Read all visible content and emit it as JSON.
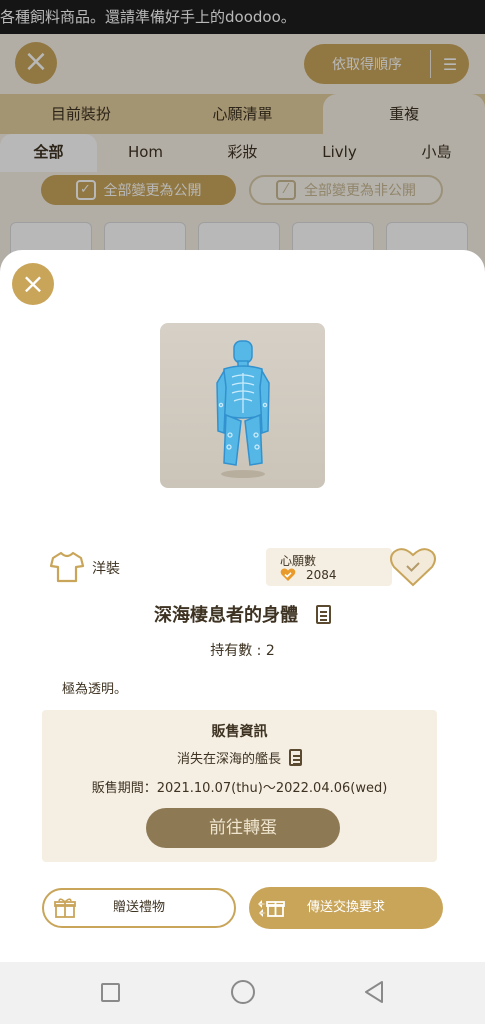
{
  "ticker": {
    "text": "各種飼料商品。還請準備好手上的doodoo。"
  },
  "background": {
    "close_icon": "close-icon",
    "sort_label": "依取得順序",
    "main_tabs": [
      {
        "label": "目前裝扮"
      },
      {
        "label": "心願清單"
      },
      {
        "label": "重複"
      }
    ],
    "sub_tabs": [
      {
        "label": "全部"
      },
      {
        "label": "Hom"
      },
      {
        "label": "彩妝"
      },
      {
        "label": "Livly"
      },
      {
        "label": "小島"
      }
    ],
    "make_public_label": "全部變更為公開",
    "make_private_label": "全部變更為非公開"
  },
  "modal": {
    "category": {
      "icon": "shirt-icon",
      "label": "洋裝"
    },
    "wishlist": {
      "label": "心願數",
      "count": "2084"
    },
    "item_name": "深海棲息者的身體",
    "owned_text": "持有數 : 2",
    "description": "極為透明。",
    "sale": {
      "title": "販售資訊",
      "source": "消失在深海的艦長",
      "period": "販售期間：2021.10.07(thu)～2022.04.06(wed)",
      "gacha_button": "前往轉蛋"
    },
    "gift_button": "贈送禮物",
    "trade_button": "傳送交換要求"
  },
  "colors": {
    "accent_gold": "#c9a55a",
    "disabled_brown": "#8d7a55",
    "panel_beige": "#f5eee2"
  }
}
